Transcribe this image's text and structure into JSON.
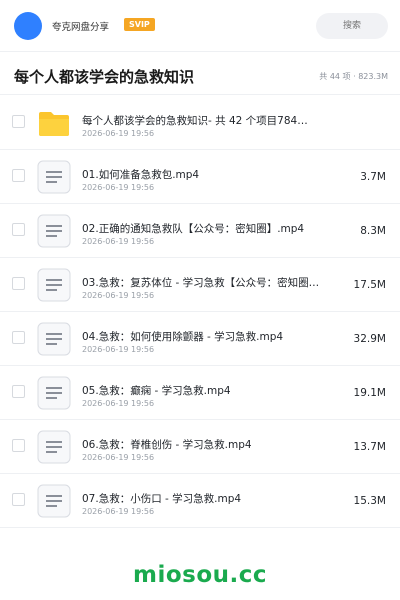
{
  "header": {
    "user_name": "夸克网盘分享",
    "badge": "SVIP",
    "search_placeholder": "搜索"
  },
  "folder": {
    "title": "每个人都该学会的急救知识",
    "summary": "共 44 项 · 823.3M"
  },
  "files": [
    {
      "type": "folder",
      "icon": "folder-icon",
      "name": "每个人都该学会的急救知识- 共 42 个项目784…",
      "date": "2026-06-19 19:56",
      "size": ""
    },
    {
      "type": "file",
      "icon": "document-icon",
      "name": "01.如何准备急救包.mp4",
      "date": "2026-06-19 19:56",
      "size": "3.7M"
    },
    {
      "type": "file",
      "icon": "document-icon",
      "name": "02.正确的通知急救队【公众号：密知圈】.mp4",
      "date": "2026-06-19 19:56",
      "size": "8.3M"
    },
    {
      "type": "file",
      "icon": "document-icon",
      "name": "03.急救：复苏体位 - 学习急救【公众号：密知圈…",
      "date": "2026-06-19 19:56",
      "size": "17.5M"
    },
    {
      "type": "file",
      "icon": "document-icon",
      "name": "04.急救：如何使用除颤器 - 学习急救.mp4",
      "date": "2026-06-19 19:56",
      "size": "32.9M"
    },
    {
      "type": "file",
      "icon": "document-icon",
      "name": "05.急救：癫痫 - 学习急救.mp4",
      "date": "2026-06-19 19:56",
      "size": "19.1M"
    },
    {
      "type": "file",
      "icon": "document-icon",
      "name": "06.急救：脊椎创伤 - 学习急救.mp4",
      "date": "2026-06-19 19:56",
      "size": "13.7M"
    },
    {
      "type": "file",
      "icon": "document-icon",
      "name": "07.急救：小伤口 - 学习急救.mp4",
      "date": "2026-06-19 19:56",
      "size": "15.3M"
    }
  ],
  "watermark": "miosou.cc",
  "colors": {
    "accent": "#2f80ff",
    "badge": "#f5a623",
    "folder": "#fbc52d",
    "watermark": "#1aaa4e"
  }
}
